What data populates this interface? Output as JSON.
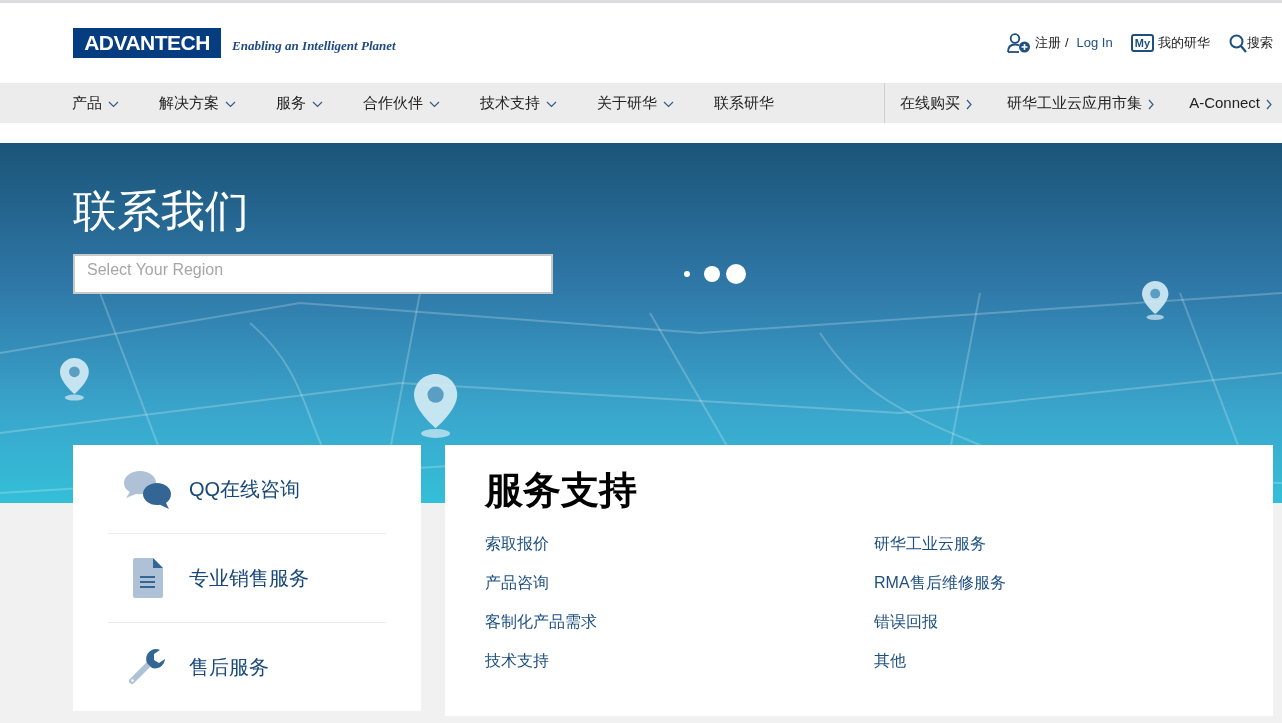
{
  "header": {
    "logo": "ADVANTECH",
    "tagline": "Enabling an Intelligent Planet",
    "register": "注册 /",
    "login": "Log In",
    "my_badge": "My",
    "my_link": "我的研华",
    "search": "搜索"
  },
  "nav": {
    "items": [
      {
        "label": "产品",
        "kind": "dropdown"
      },
      {
        "label": "解决方案",
        "kind": "dropdown"
      },
      {
        "label": "服务",
        "kind": "dropdown"
      },
      {
        "label": "合作伙伴",
        "kind": "dropdown"
      },
      {
        "label": "技术支持",
        "kind": "dropdown"
      },
      {
        "label": "关于研华",
        "kind": "dropdown"
      },
      {
        "label": "联系研华",
        "kind": "plain"
      }
    ],
    "right_items": [
      {
        "label": "在线购买"
      },
      {
        "label": "研华工业云应用市集"
      },
      {
        "label": "A-Connect"
      }
    ]
  },
  "hero": {
    "title": "联系我们",
    "region_select": {
      "placeholder": "Select Your Region"
    }
  },
  "contact_options": [
    {
      "label": "QQ在线咨询",
      "kind": "chat"
    },
    {
      "label": "专业销售服务",
      "kind": "document"
    },
    {
      "label": "售后服务",
      "kind": "wrench"
    }
  ],
  "service_support": {
    "title": "服务支持",
    "links": [
      [
        "索取报价",
        "产品咨询",
        "客制化产品需求",
        "技术支持"
      ],
      [
        "研华工业云服务",
        "RMA售后维修服务",
        "错误回报",
        "其他"
      ]
    ]
  }
}
